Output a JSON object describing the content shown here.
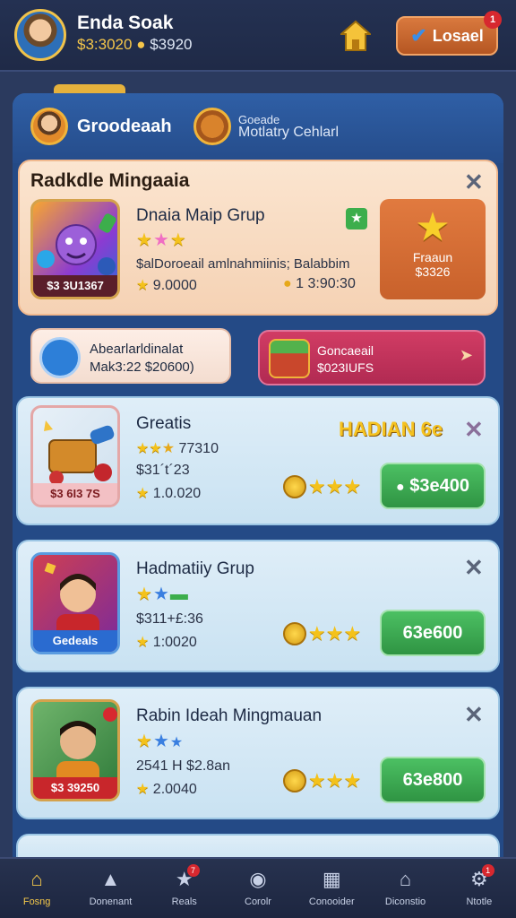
{
  "player": {
    "name": "Enda Soak",
    "coins_a": "$3:3020",
    "coins_b": "$3920"
  },
  "header": {
    "load_label": "Losael",
    "load_badge": "1"
  },
  "tabs": [
    {
      "label": "Groodeaah"
    },
    {
      "small": "Goeade",
      "label": "Motlatry Cehlarl"
    }
  ],
  "featured": {
    "section_title": "Radkdle Mingaaia",
    "game_title": "Dnaia Maip Grup",
    "thumb_caption": "$3 3U1367",
    "stars": [
      "yellow",
      "pink",
      "yellow"
    ],
    "desc": "$alDoroeail amlnahmiinis; Balabbim",
    "stat_left": "9.0000",
    "stat_right": "1 3:90:30",
    "reward_line1": "Fraaun",
    "reward_line2": "$3326"
  },
  "promos": [
    {
      "line1": "Abearlarldinalat",
      "line2": "Mak3:22  $20600)"
    },
    {
      "line1": "Goncaeail",
      "line2": "$023IUFS"
    }
  ],
  "games": [
    {
      "title": "Greatis",
      "thumb_caption": "$3 6I3 7S",
      "rating_text": "77310",
      "stat1": "$31´t´23",
      "stat2": "1.0.020",
      "badge": "HADIAN  6e",
      "button": "$3e400"
    },
    {
      "title": "Hadmatiiy Grup",
      "thumb_caption": "Gedeals",
      "stat1": "$311+£:36",
      "stat2": "1:0020",
      "button": "63e600"
    },
    {
      "title": "Rabin Ideah Mingmauan",
      "thumb_caption": "$3 39250",
      "stat1": "2541 H $2.8an",
      "stat2": "2.0040",
      "button": "63e800"
    }
  ],
  "nav": [
    {
      "label": "Fosng",
      "icon": "home-icon",
      "active": true
    },
    {
      "label": "Donenant",
      "icon": "card-icon"
    },
    {
      "label": "Reals",
      "icon": "star-icon",
      "badge": "7"
    },
    {
      "label": "Corolr",
      "icon": "circle-icon"
    },
    {
      "label": "Conooider",
      "icon": "board-icon"
    },
    {
      "label": "Diconstio",
      "icon": "building-icon"
    },
    {
      "label": "Ntotle",
      "icon": "gear-icon",
      "badge": "1"
    }
  ],
  "colors": {
    "accent_gold": "#f4c84a",
    "panel_blue": "#244a86",
    "green_button": "#3caa52"
  }
}
